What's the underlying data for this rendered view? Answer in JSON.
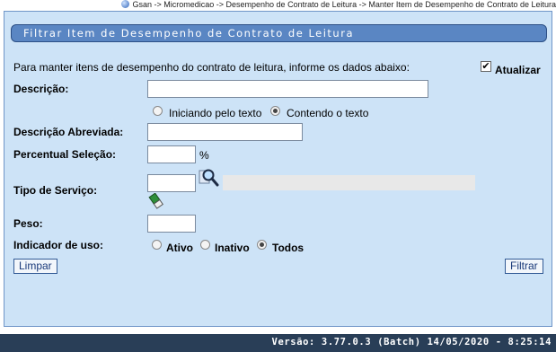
{
  "breadcrumb": "Gsan -> Micromedicao -> Desempenho de Contrato de Leitura -> Manter Item de Desempenho de Contrato de Leitura",
  "title": "Filtrar Item de Desempenho de Contrato de Leitura",
  "instruction": "Para manter itens de desempenho do contrato de leitura, informe os dados abaixo:",
  "atualizar": {
    "label": "Atualizar",
    "checked": true
  },
  "descricao": {
    "label": "Descrição:",
    "value": ""
  },
  "search_mode": {
    "options": [
      "Iniciando pelo texto",
      "Contendo o texto"
    ],
    "selected": "Contendo o texto"
  },
  "descricao_abreviada": {
    "label": "Descrição Abreviada:",
    "value": ""
  },
  "percentual_selecao": {
    "label": "Percentual Seleção:",
    "value": "",
    "unit": "%"
  },
  "tipo_servico": {
    "label": "Tipo de Serviço:",
    "code": "",
    "description": ""
  },
  "peso": {
    "label": "Peso:",
    "value": ""
  },
  "indicador_uso": {
    "label": "Indicador de uso:",
    "options": [
      "Ativo",
      "Inativo",
      "Todos"
    ],
    "selected": "Todos"
  },
  "buttons": {
    "limpar": "Limpar",
    "filtrar": "Filtrar"
  },
  "footer": "Versão: 3.77.0.3 (Batch) 14/05/2020 - 8:25:14",
  "colors": {
    "panel": "#cde3f7",
    "title_bar": "#5a86c3",
    "footer": "#293e57"
  }
}
